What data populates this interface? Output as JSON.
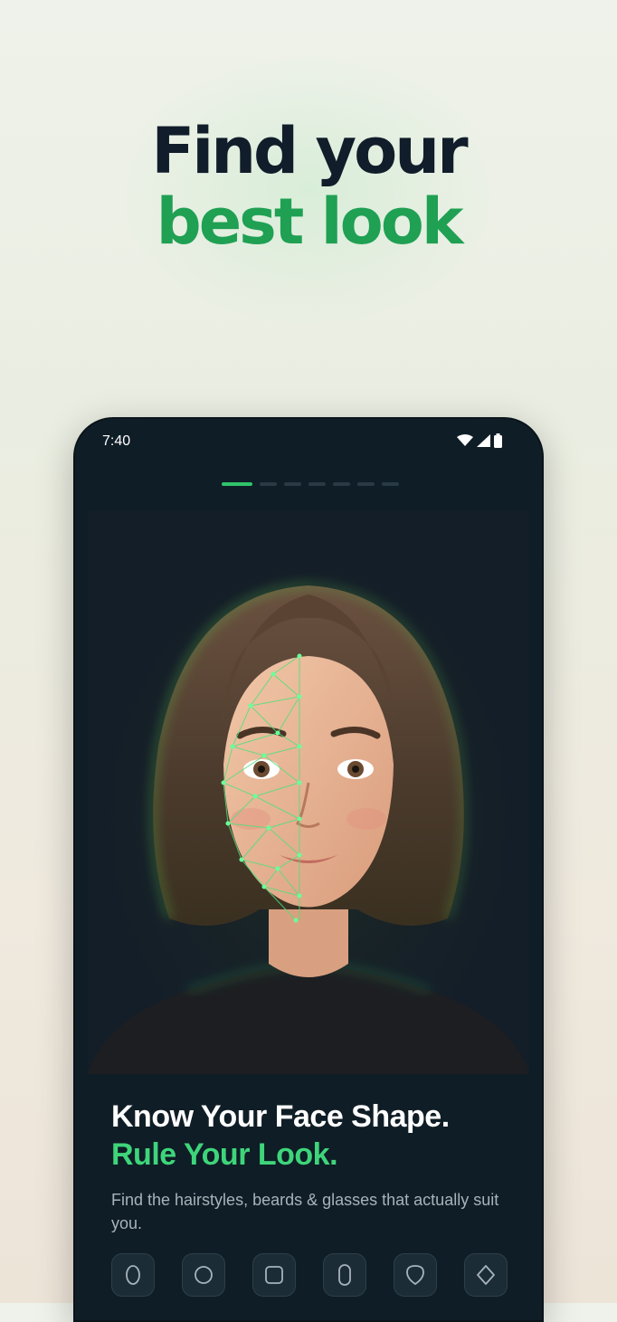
{
  "headline": {
    "line1": "Find your",
    "line2": "best look",
    "colors": {
      "dark": "#111d2a",
      "accent": "#1fa053"
    }
  },
  "phone": {
    "status_bar": {
      "time": "7:40",
      "icons": [
        "wifi-icon",
        "signal-icon",
        "battery-icon"
      ]
    },
    "progress": {
      "total_steps": 7,
      "current_step": 1
    },
    "hero_image": {
      "description_icon": "face-scan-illustration"
    },
    "card": {
      "title_line1": "Know Your Face Shape.",
      "title_line2": "Rule Your Look.",
      "subtitle": "Find the hairstyles, beards & glasses that actually suit you."
    },
    "face_shapes": [
      {
        "icon": "oval-face-icon"
      },
      {
        "icon": "round-face-icon"
      },
      {
        "icon": "square-face-icon"
      },
      {
        "icon": "oblong-face-icon"
      },
      {
        "icon": "heart-face-icon"
      },
      {
        "icon": "diamond-face-icon"
      }
    ],
    "colors": {
      "background": "#0f1d26",
      "accent": "#3ed57a"
    }
  }
}
